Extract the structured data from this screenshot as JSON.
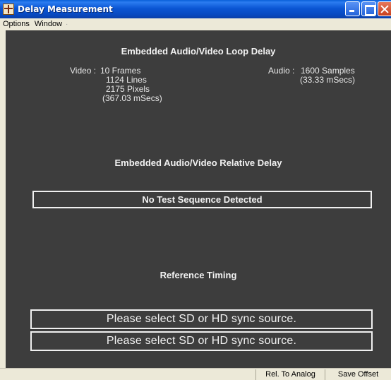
{
  "window": {
    "title": "Delay Measurement"
  },
  "menu": {
    "items": [
      "Options",
      "Window"
    ]
  },
  "loop_delay": {
    "heading": "Embedded Audio/Video Loop Delay",
    "video_label": "Video :",
    "video_frames": "10 Frames",
    "video_lines": "1124 Lines",
    "video_pixels": "2175 Pixels",
    "video_msecs": "(367.03 mSecs)",
    "audio_label": "Audio :",
    "audio_samples": "1600 Samples",
    "audio_msecs": "(33.33 mSecs)"
  },
  "relative_delay": {
    "heading": "Embedded Audio/Video Relative Delay",
    "status": "No Test Sequence Detected"
  },
  "reference_timing": {
    "heading": "Reference Timing",
    "line1": "Please select SD or HD sync source.",
    "line2": "Please select SD or HD sync source."
  },
  "statusbar": {
    "rel_to_analog": "Rel. To Analog",
    "save_offset": "Save Offset"
  },
  "colors": {
    "client_bg": "#3d3d3d",
    "titlebar_blue": "#0b56d4"
  }
}
